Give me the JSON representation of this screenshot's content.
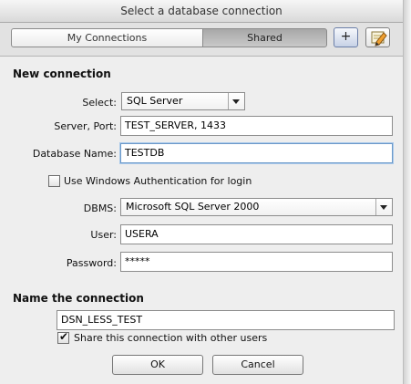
{
  "window": {
    "title": "Select a database connection"
  },
  "tabs": {
    "my_connections": "My Connections",
    "shared": "Shared"
  },
  "toolbar": {
    "add_symbol": "+"
  },
  "new_connection": {
    "heading": "New connection",
    "select_label": "Select:",
    "select_value": "SQL Server",
    "server_label": "Server, Port:",
    "server_value": "TEST_SERVER, 1433",
    "database_label": "Database Name:",
    "database_value": "TESTDB",
    "windows_auth_label": "Use Windows Authentication for login",
    "dbms_label": "DBMS:",
    "dbms_value": "Microsoft SQL Server 2000",
    "user_label": "User:",
    "user_value": "USERA",
    "password_label": "Password:",
    "password_value": "*****"
  },
  "name_connection": {
    "heading": "Name the connection",
    "name_value": "DSN_LESS_TEST",
    "share_label": "Share this connection with other users",
    "share_checked": true
  },
  "buttons": {
    "ok": "OK",
    "cancel": "Cancel"
  },
  "colors": {
    "focus_border": "#6b99c9",
    "panel_bg": "#eeeeee",
    "shared_tab_bg": "#b4b4b4"
  }
}
